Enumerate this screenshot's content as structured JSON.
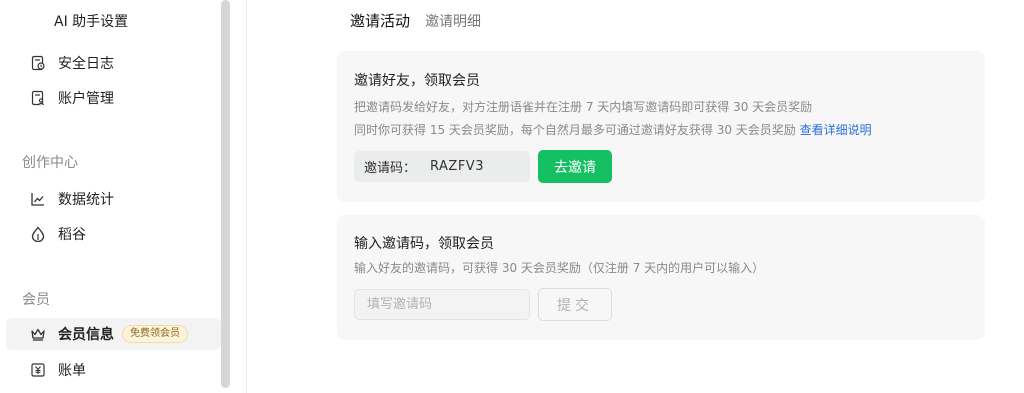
{
  "sidebar": {
    "top_item": "AI 助手设置",
    "items_a": [
      {
        "label": "安全日志",
        "icon": "log-document-icon"
      },
      {
        "label": "账户管理",
        "icon": "account-document-icon"
      }
    ],
    "section_creation": "创作中心",
    "items_b": [
      {
        "label": "数据统计",
        "icon": "line-chart-icon"
      },
      {
        "label": "稻谷",
        "icon": "rice-grain-icon"
      }
    ],
    "section_member": "会员",
    "items_c": [
      {
        "label": "会员信息",
        "icon": "crown-icon",
        "badge": "免费领会员",
        "active": true
      },
      {
        "label": "账单",
        "icon": "yen-bill-icon"
      }
    ]
  },
  "tabs": {
    "active": "邀请活动",
    "other": "邀请明细"
  },
  "invite_card": {
    "title": "邀请好友，领取会员",
    "desc1": "把邀请码发给好友，对方注册语雀并在注册 7 天内填写邀请码即可获得 30 天会员奖励",
    "desc2": "同时你可获得 15 天会员奖励，每个自然月最多可通过邀请好友获得 30 天会员奖励",
    "detail_link": "查看详细说明",
    "code_label": "邀请码：",
    "code_value": "RAZFV3",
    "invite_button": "去邀请"
  },
  "enter_card": {
    "title": "输入邀请码，领取会员",
    "desc": "输入好友的邀请码，可获得 30 天会员奖励（仅注册 7 天内的用户可以输入）",
    "input_placeholder": "填写邀请码",
    "submit_button": "提交"
  },
  "colors": {
    "accent_green": "#15c063",
    "link_blue": "#2c6fdb"
  }
}
